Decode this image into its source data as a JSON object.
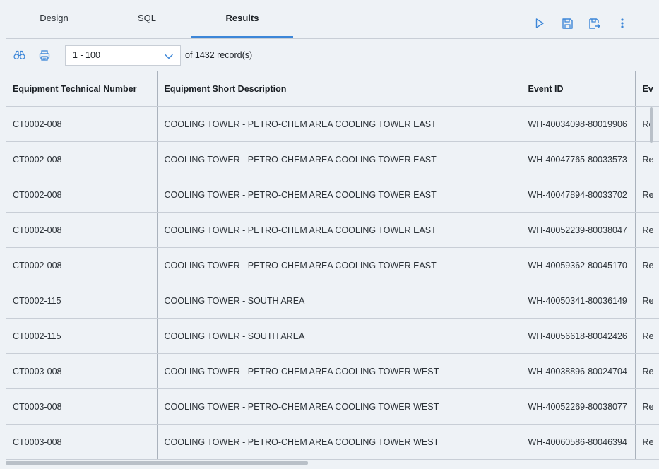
{
  "tabs": [
    {
      "label": "Design",
      "active": false
    },
    {
      "label": "SQL",
      "active": false
    },
    {
      "label": "Results",
      "active": true
    }
  ],
  "toolbar": {
    "icons": [
      "play-icon",
      "save-icon",
      "save-as-icon",
      "more-vertical-icon"
    ]
  },
  "records": {
    "page_range": "1 - 100",
    "of_text": "of 1432  record(s)"
  },
  "colors": {
    "accent": "#3c86d8",
    "icon": "#3c86d8",
    "background": "#eef2f6",
    "border": "#c8ced6"
  },
  "table": {
    "columns": [
      "Equipment Technical Number",
      "Equipment Short Description",
      "Event ID",
      "Ev"
    ],
    "rows": [
      [
        "CT0002-008",
        "COOLING TOWER - PETRO-CHEM AREA COOLING TOWER EAST",
        "WH-40034098-80019906",
        "Re"
      ],
      [
        "CT0002-008",
        "COOLING TOWER - PETRO-CHEM AREA COOLING TOWER EAST",
        "WH-40047765-80033573",
        "Re"
      ],
      [
        "CT0002-008",
        "COOLING TOWER - PETRO-CHEM AREA COOLING TOWER EAST",
        "WH-40047894-80033702",
        "Re"
      ],
      [
        "CT0002-008",
        "COOLING TOWER - PETRO-CHEM AREA COOLING TOWER EAST",
        "WH-40052239-80038047",
        "Re"
      ],
      [
        "CT0002-008",
        "COOLING TOWER - PETRO-CHEM AREA COOLING TOWER EAST",
        "WH-40059362-80045170",
        "Re"
      ],
      [
        "CT0002-115",
        "COOLING TOWER - SOUTH AREA",
        "WH-40050341-80036149",
        "Re"
      ],
      [
        "CT0002-115",
        "COOLING TOWER - SOUTH AREA",
        "WH-40056618-80042426",
        "Re"
      ],
      [
        "CT0003-008",
        "COOLING TOWER - PETRO-CHEM AREA COOLING TOWER WEST",
        "WH-40038896-80024704",
        "Re"
      ],
      [
        "CT0003-008",
        "COOLING TOWER - PETRO-CHEM AREA COOLING TOWER WEST",
        "WH-40052269-80038077",
        "Re"
      ],
      [
        "CT0003-008",
        "COOLING TOWER - PETRO-CHEM AREA COOLING TOWER WEST",
        "WH-40060586-80046394",
        "Re"
      ]
    ]
  }
}
